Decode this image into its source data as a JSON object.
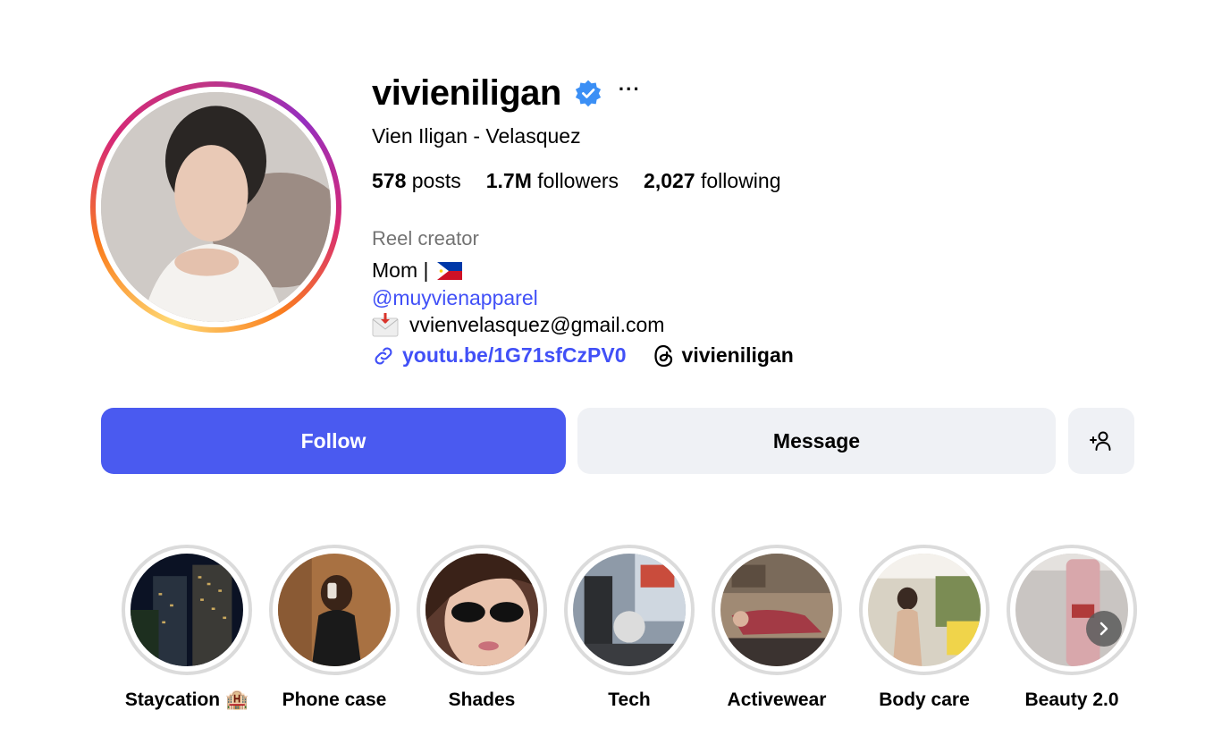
{
  "profile": {
    "username": "vivieniligan",
    "full_name": "Vien Iligan - Velasquez",
    "more_label": "···",
    "stats": {
      "posts_count": "578",
      "posts_label": " posts",
      "followers_count": "1.7M",
      "followers_label": " followers",
      "following_count": "2,027",
      "following_label": " following"
    },
    "category": "Reel creator",
    "bio_text": "Mom |",
    "mention": "@muyvienapparel",
    "email": "vvienvelasquez@gmail.com",
    "link": "youtu.be/1G71sfCzPV0",
    "threads_handle": "vivieniligan"
  },
  "actions": {
    "follow_label": "Follow",
    "message_label": "Message"
  },
  "highlights": [
    {
      "label": "Staycation 🏨"
    },
    {
      "label": "Phone case"
    },
    {
      "label": "Shades"
    },
    {
      "label": "Tech"
    },
    {
      "label": "Activewear"
    },
    {
      "label": "Body care"
    },
    {
      "label": "Beauty 2.0"
    }
  ],
  "colors": {
    "accent": "#4a5af0",
    "link": "#4150f7",
    "verified": "#3b8ff5",
    "muted": "#737373",
    "button_secondary": "#eff1f5"
  },
  "icons": {
    "verified": "verified-badge-icon",
    "more": "more-options-icon",
    "link": "link-icon",
    "threads": "threads-icon",
    "add_user": "add-person-icon",
    "next": "chevron-right-icon"
  }
}
